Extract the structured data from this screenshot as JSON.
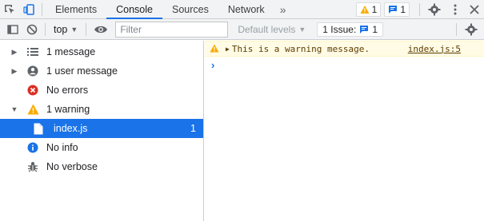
{
  "tabs": {
    "items": [
      "Elements",
      "Console",
      "Sources",
      "Network"
    ],
    "active": "Console",
    "more": "»"
  },
  "badges": {
    "warnings_count": "1",
    "messages_count": "1"
  },
  "toolbar": {
    "context": "top",
    "filter_placeholder": "Filter",
    "levels_label": "Default levels",
    "issue_label": "1 Issue:",
    "issue_count": "1"
  },
  "sidebar": {
    "items": [
      {
        "label": "1 message",
        "icon": "list-icon"
      },
      {
        "label": "1 user message",
        "icon": "user-icon"
      },
      {
        "label": "No errors",
        "icon": "error-icon"
      },
      {
        "label": "1 warning",
        "icon": "warning-icon"
      },
      {
        "label": "index.js",
        "icon": "file-icon",
        "count": "1"
      },
      {
        "label": "No info",
        "icon": "info-icon"
      },
      {
        "label": "No verbose",
        "icon": "bug-icon"
      }
    ]
  },
  "console": {
    "warning_message": "This is a warning message.",
    "warning_source": "index.js:5",
    "prompt": "›"
  },
  "colors": {
    "accent": "#1a73e8",
    "warning_bg": "#fffbe5",
    "warning_icon": "#f9ab00",
    "error_icon": "#d93025"
  }
}
